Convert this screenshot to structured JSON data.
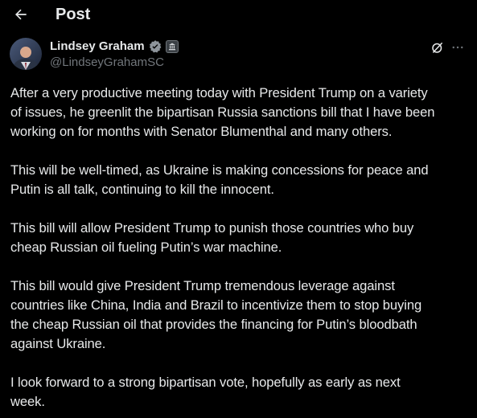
{
  "header": {
    "title": "Post",
    "back_icon": "arrow-left-icon"
  },
  "author": {
    "name": "Lindsey Graham",
    "handle": "@LindseyGrahamSC",
    "verified_badge_icon": "verified-badge-icon",
    "affiliation_badge_icon": "government-badge-icon"
  },
  "actions": {
    "grok_icon": "grok-icon",
    "more_icon": "more-horizontal-icon"
  },
  "tweet": {
    "paragraphs": [
      "After a very productive meeting today with President Trump on a variety\nof issues, he greenlit the bipartisan Russia sanctions bill that I have been\nworking on for months with Senator Blumenthal and many others.",
      "This will be well-timed, as Ukraine is making concessions for peace and\nPutin is all talk, continuing to kill the innocent.",
      "This bill will allow President Trump to punish those countries who buy\ncheap Russian oil fueling Putin’s war machine.",
      "This bill would give President Trump tremendous leverage against\ncountries like China, India and Brazil to incentivize them to stop buying\nthe cheap Russian oil that provides the financing for Putin’s bloodbath\nagainst Ukraine.",
      "I look forward to a strong bipartisan vote, hopefully as early as next\nweek."
    ]
  },
  "colors": {
    "background": "#000000",
    "text_primary": "#e7e9ea",
    "text_secondary": "#71767b",
    "verified_blue": "#1d9bf0"
  }
}
